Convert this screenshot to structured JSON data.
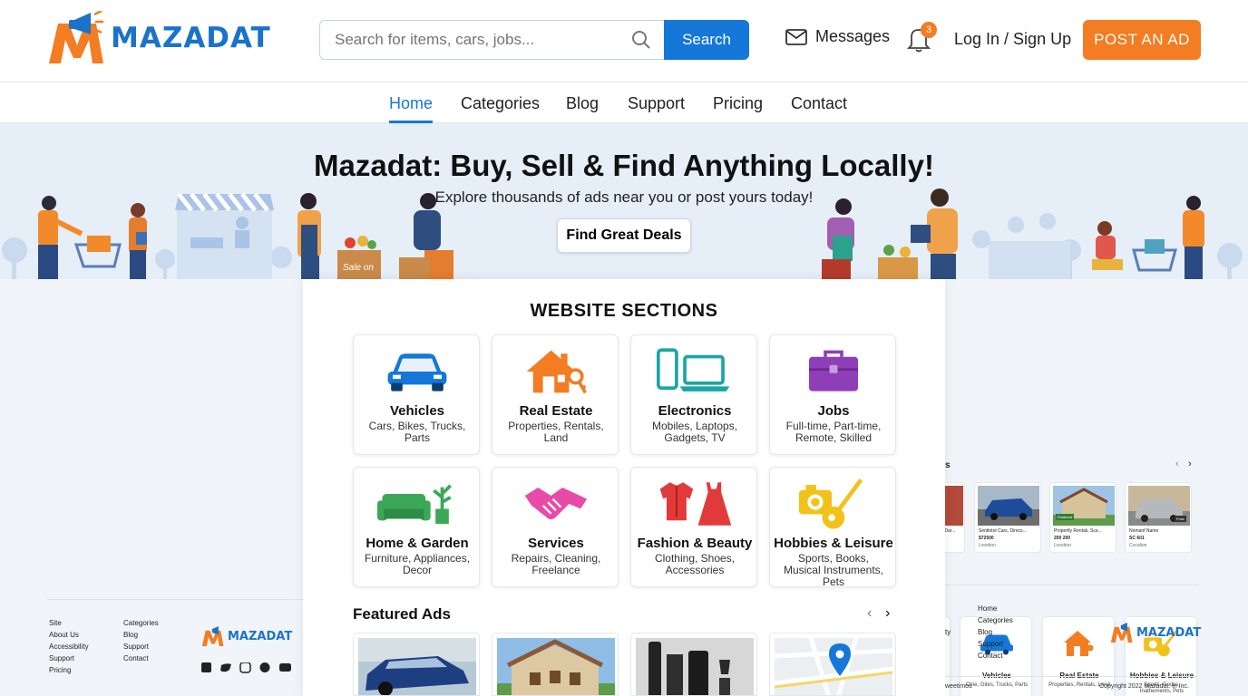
{
  "header": {
    "logo_text": "MAZADAT",
    "search_placeholder": "Search for items, cars, jobs...",
    "search_button": "Search",
    "messages": "Messages",
    "notification_count": "3",
    "login": "Log In / Sign Up",
    "post_ad": "POST AN AD"
  },
  "nav": {
    "items": [
      "Home",
      "Categories",
      "Blog",
      "Support",
      "Pricing",
      "Contact"
    ]
  },
  "hero": {
    "title": "Mazadat: Buy, Sell & Find Anything Locally!",
    "subtitle": "Explore thousands of ads near you or post yours today!",
    "cta": "Find Great Deals",
    "shop_sign": "Sale on"
  },
  "sections": {
    "title": "WEBSITE SECTIONS",
    "cards": [
      {
        "title": "Vehicles",
        "sub": "Cars, Bikes, Trucks, Parts"
      },
      {
        "title": "Real Estate",
        "sub": "Properties, Rentals, Land"
      },
      {
        "title": "Electronics",
        "sub": "Mobiles, Laptops, Gadgets, TV"
      },
      {
        "title": "Jobs",
        "sub": "Full-time, Part-time, Remote, Skilled"
      },
      {
        "title": "Home & Garden",
        "sub": "Furniture, Appliances, Decor"
      },
      {
        "title": "Services",
        "sub": "Repairs, Cleaning, Freelance"
      },
      {
        "title": "Fashion & Beauty",
        "sub": "Clothing, Shoes, Accessories"
      },
      {
        "title": "Hobbies & Leisure",
        "sub": "Sports, Books, Musical Instruments, Pets"
      }
    ]
  },
  "featured": {
    "title": "Featured Ads",
    "prev": "‹",
    "next": "›"
  },
  "right_preview": {
    "cards": [
      {
        "title": "Vehicles",
        "sub": "Ctne, Gites, Trucks, Parts"
      },
      {
        "title": "Real Estate",
        "sub": "Properties, Rentals, Land"
      },
      {
        "title": "Hobbies & Leisure",
        "sub": "Sports, Gooks, Inathements, Pets"
      }
    ],
    "section_letter": "s",
    "prev": "‹",
    "next": "›",
    "ads": [
      {
        "title": "Sentletot Cars, Direcs...",
        "price": "$72500",
        "loc": "Locetion"
      },
      {
        "title": "Propertly Rentak, Sce...",
        "price": "200 200",
        "loc": "Locetion"
      },
      {
        "title": "Nomanf Name",
        "price": "SC 6il1",
        "loc": "Cocalion"
      }
    ],
    "ad_partial": "A Dar...",
    "badges": [
      "Featured",
      "Fmtc"
    ],
    "footer_links": [
      "Home",
      "Categories",
      "Blog",
      "Support",
      "Contact"
    ],
    "footer_partial": "ty",
    "logo_text": "MAZADAT",
    "copyright": "Copyright 2022 Mazadat. in Inc.",
    "left_snippet": "weetimos"
  },
  "left_footer": {
    "col1": [
      "Site",
      "About Us",
      "Accessibility",
      "Support",
      "Pricing"
    ],
    "col2": [
      "Categories",
      "Blog",
      "Support",
      "Contact"
    ],
    "logo_text": "MAZADAT"
  },
  "colors": {
    "primary": "#1577d8",
    "accent": "#f47c22"
  }
}
